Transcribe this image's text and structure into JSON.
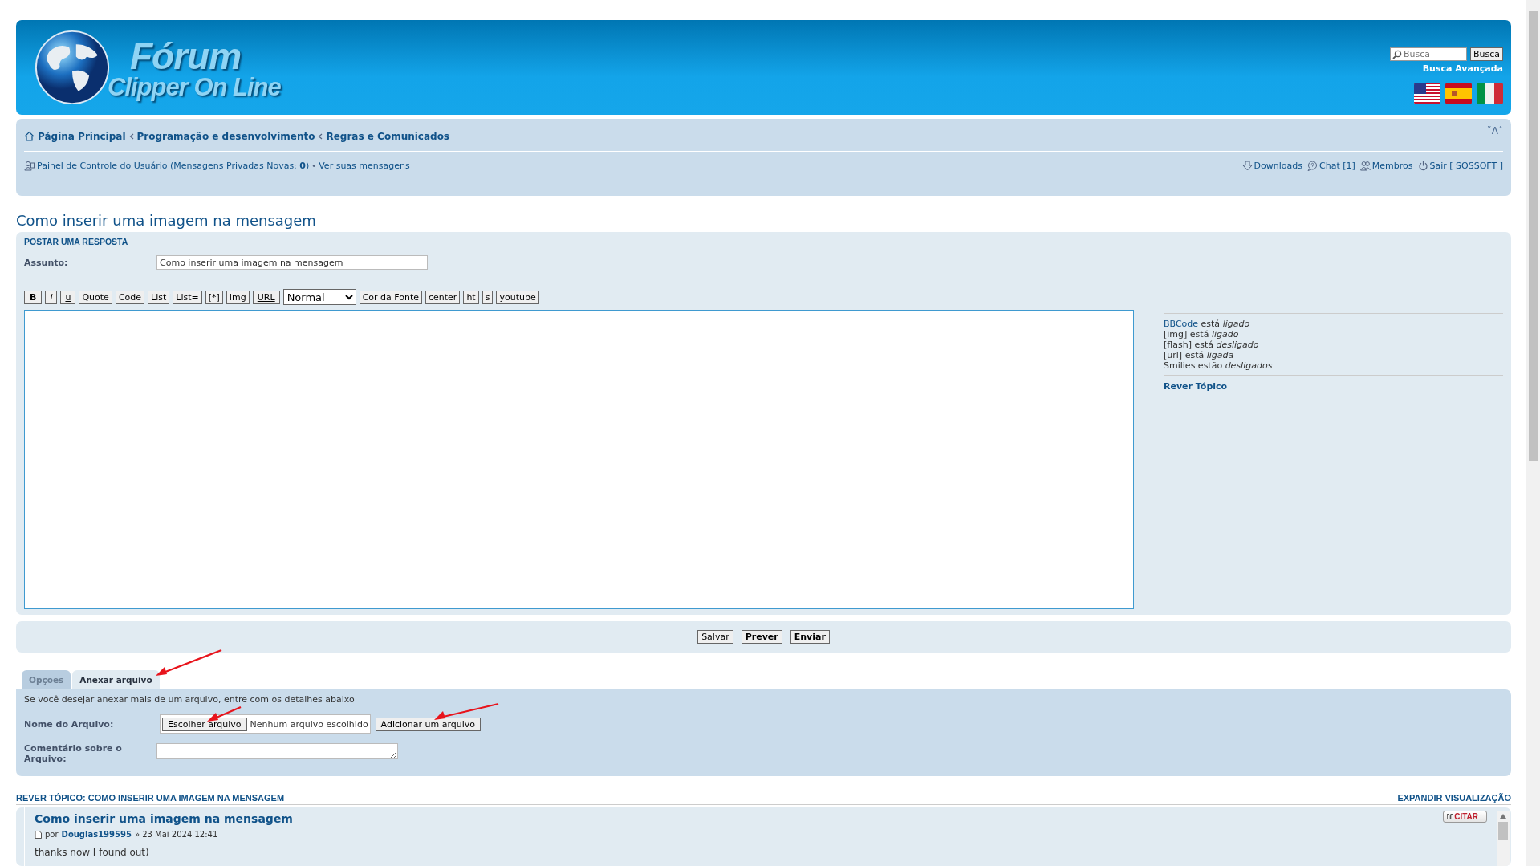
{
  "header": {
    "logo_title": "Fórum",
    "logo_subtitle": "Clipper On Line",
    "search": {
      "placeholder": "Busca"
    },
    "search_button": "Busca",
    "advanced_search": "Busca Avançada"
  },
  "breadcrumbs": [
    {
      "label": "Página Principal"
    },
    {
      "label": "Programação e desenvolvimento"
    },
    {
      "label": "Regras e Comunicados"
    }
  ],
  "font_controls": "˅A˄",
  "user_bar": {
    "control_panel": "Painel de Controle do Usuário (Mensagens Privadas Novas: **0**)",
    "separator": "•",
    "messages_link": "Ver suas mensagens",
    "links": [
      {
        "kind": "download",
        "label": "Downloads"
      },
      {
        "kind": "chat",
        "label": "Chat [1]"
      },
      {
        "kind": "members",
        "label": "Membros"
      },
      {
        "kind": "logout",
        "label": "Sair [ SOSSOFT ]"
      }
    ]
  },
  "topic_title": "Como inserir uma imagem na mensagem",
  "post_form": {
    "heading": "POSTAR UMA RESPOSTA",
    "subject_label": "Assunto:",
    "subject_value": "Como inserir uma imagem na mensagem",
    "toolbar": [
      {
        "kind": "bold",
        "label": "B"
      },
      {
        "kind": "italic",
        "label": "i"
      },
      {
        "kind": "underline",
        "label": "u"
      },
      {
        "kind": "button",
        "label": "Quote"
      },
      {
        "kind": "button",
        "label": "Code"
      },
      {
        "kind": "button",
        "label": "List"
      },
      {
        "kind": "button",
        "label": "List="
      },
      {
        "kind": "button",
        "label": "[*]"
      },
      {
        "kind": "button",
        "label": "Img"
      },
      {
        "kind": "underline",
        "label": "URL"
      },
      {
        "kind": "select",
        "label": "Normal"
      },
      {
        "kind": "button",
        "label": "Cor da Fonte"
      },
      {
        "kind": "button",
        "label": "center"
      },
      {
        "kind": "button",
        "label": "ht"
      },
      {
        "kind": "button",
        "label": "s"
      },
      {
        "kind": "button",
        "label": "youtube"
      }
    ],
    "options": [
      {
        "link": "BBCode",
        "text": "está *ligado*"
      },
      {
        "text": "[img] está *ligado*"
      },
      {
        "text": "[flash] está *desligado*"
      },
      {
        "text": "[url] está *ligada*"
      },
      {
        "text": "Smilies estão *desligados*"
      }
    ],
    "review_link": "Rever Tópico"
  },
  "submit_buttons": [
    {
      "label": "Salvar",
      "primary": false
    },
    {
      "label": "Prever",
      "primary": true
    },
    {
      "label": "Enviar",
      "primary": true
    }
  ],
  "attachment_tabs": [
    {
      "label": "Opções",
      "selected": false,
      "arrow": false
    },
    {
      "label": "Anexar arquivo",
      "selected": true,
      "arrow": true
    }
  ],
  "attachment": {
    "intro": "Se você desejar anexar mais de um arquivo, entre com os detalhes abaixo",
    "filename_label": "Nome do Arquivo:",
    "choose_button": {
      "label": "Escolher arquivo",
      "arrow": true
    },
    "no_file": "Nenhum arquivo escolhido",
    "add_button": {
      "label": "Adicionar um arquivo",
      "arrow": true
    },
    "comment_label": "Comentário sobre o Arquivo:"
  },
  "review": {
    "heading": "REVER TÓPICO: COMO INSERIR UMA IMAGEM NA MENSAGEM",
    "expand": "EXPANDIR VISUALIZAÇÃO",
    "posts": [
      {
        "title": "Como inserir uma imagem na mensagem",
        "by": "por",
        "author": "Douglas199595",
        "date": "» 23 Mai 2024 12:41",
        "body": "thanks now I found out)",
        "quote_button": "CITAR"
      }
    ]
  }
}
